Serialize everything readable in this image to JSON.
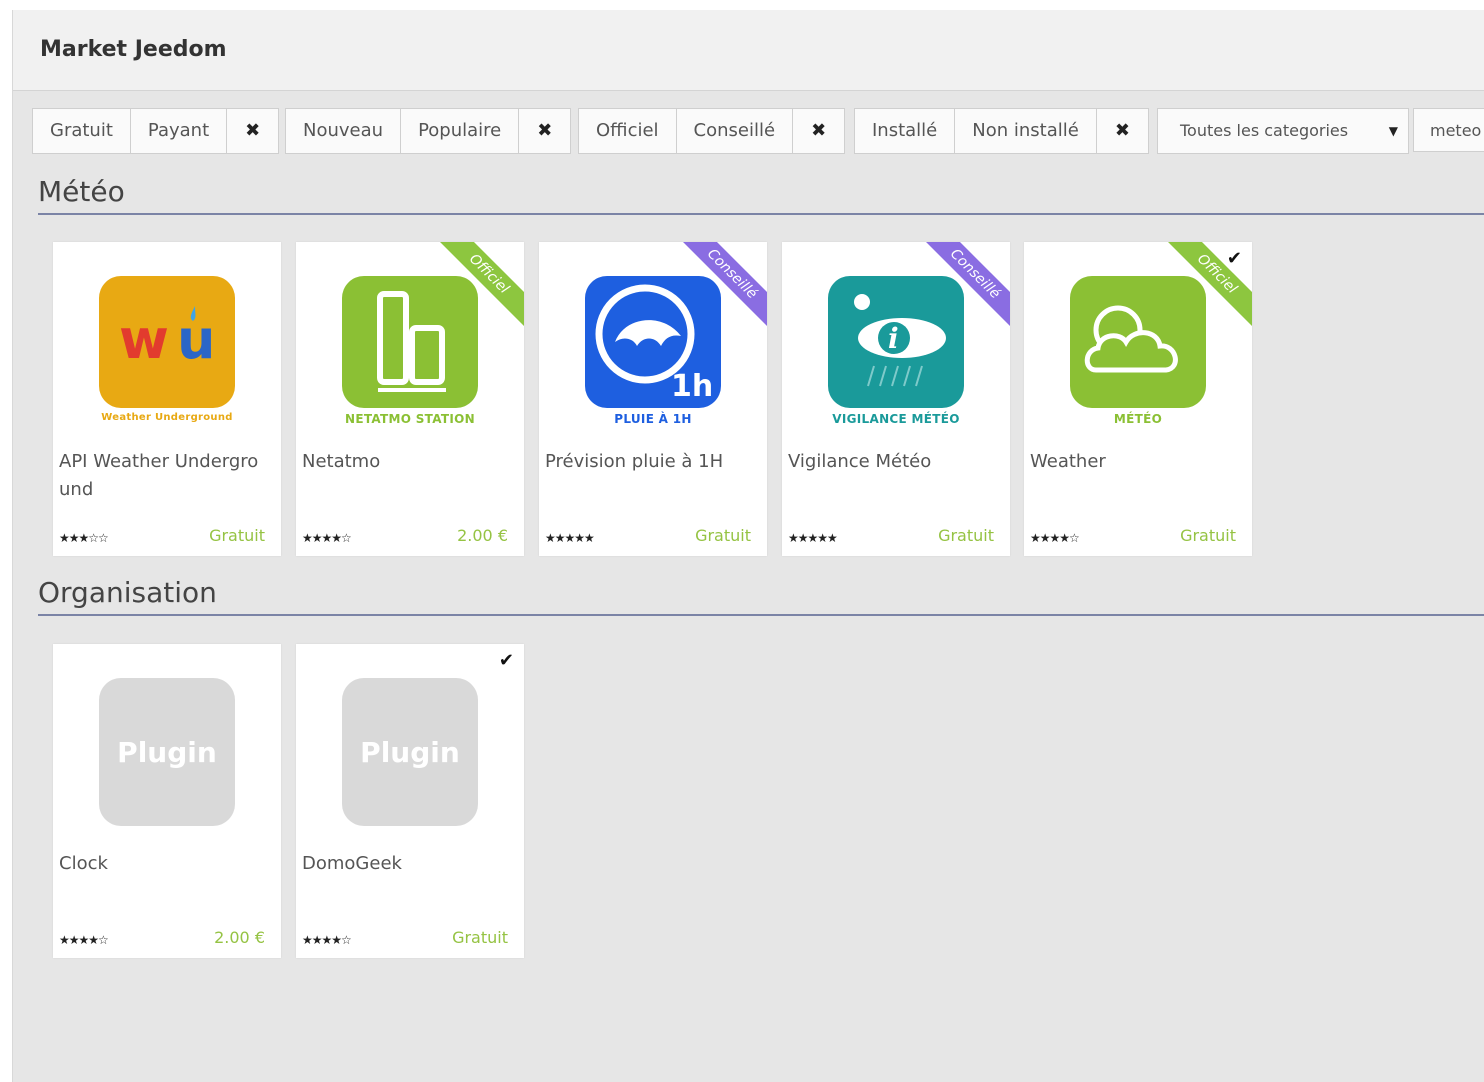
{
  "header": {
    "title": "Market Jeedom"
  },
  "filters": {
    "price": [
      "Gratuit",
      "Payant"
    ],
    "trend": [
      "Nouveau",
      "Populaire"
    ],
    "certification": [
      "Officiel",
      "Conseillé"
    ],
    "install": [
      "Installé",
      "Non installé"
    ],
    "clear_glyph": "✖",
    "category_select": {
      "value": "Toutes les categories",
      "caret": "▼"
    },
    "search": {
      "value": "meteo"
    }
  },
  "sections": [
    {
      "title": "Météo",
      "plugins": [
        {
          "name": "API Weather Undergro und",
          "caption": "Weather Underground",
          "stars": "★★★☆☆",
          "rating": 3,
          "price": "Gratuit",
          "ribbon": "",
          "installed": false,
          "icon": "weather-underground-icon"
        },
        {
          "name": "Netatmo",
          "caption": "NETATMO STATION",
          "stars": "★★★★☆",
          "rating": 4,
          "price": "2.00 €",
          "ribbon": "Officiel",
          "installed": false,
          "icon": "netatmo-station-icon"
        },
        {
          "name": "Prévision pluie à 1H",
          "caption": "PLUIE À 1H",
          "stars": "★★★★★",
          "rating": 5,
          "price": "Gratuit",
          "ribbon": "Conseillé",
          "installed": false,
          "icon": "rain-1h-icon",
          "icon_text": "1h"
        },
        {
          "name": "Vigilance Météo",
          "caption": "VIGILANCE MÉTÉO",
          "stars": "★★★★★",
          "rating": 5,
          "price": "Gratuit",
          "ribbon": "Conseillé",
          "installed": false,
          "icon": "vigilance-meteo-icon",
          "icon_text": "i"
        },
        {
          "name": "Weather",
          "caption": "MÉTÉO",
          "stars": "★★★★☆",
          "rating": 4,
          "price": "Gratuit",
          "ribbon": "Officiel",
          "installed": true,
          "icon": "weather-cloud-icon"
        }
      ]
    },
    {
      "title": "Organisation",
      "plugins": [
        {
          "name": "Clock",
          "caption": "",
          "stars": "★★★★☆",
          "rating": 4,
          "price": "2.00 €",
          "ribbon": "",
          "installed": false,
          "icon": "plugin-placeholder-icon",
          "icon_text": "Plugin"
        },
        {
          "name": "DomoGeek",
          "caption": "",
          "stars": "★★★★☆",
          "rating": 4,
          "price": "Gratuit",
          "ribbon": "",
          "installed": true,
          "icon": "plugin-placeholder-icon",
          "icon_text": "Plugin"
        }
      ]
    }
  ],
  "installed_glyph": "✔",
  "colors": {
    "price": "#95c343",
    "official_ribbon": "#8dc63f",
    "advised_ribbon": "#8a6de2",
    "section_rule": "#7b84a6",
    "wu_icon": "#e8a913",
    "netatmo_icon": "#8bc034",
    "rain_icon": "#1e5fe0",
    "vigilance_icon": "#1a9a9a",
    "weather_icon": "#8bc034",
    "placeholder_icon": "#d9d9d9"
  }
}
